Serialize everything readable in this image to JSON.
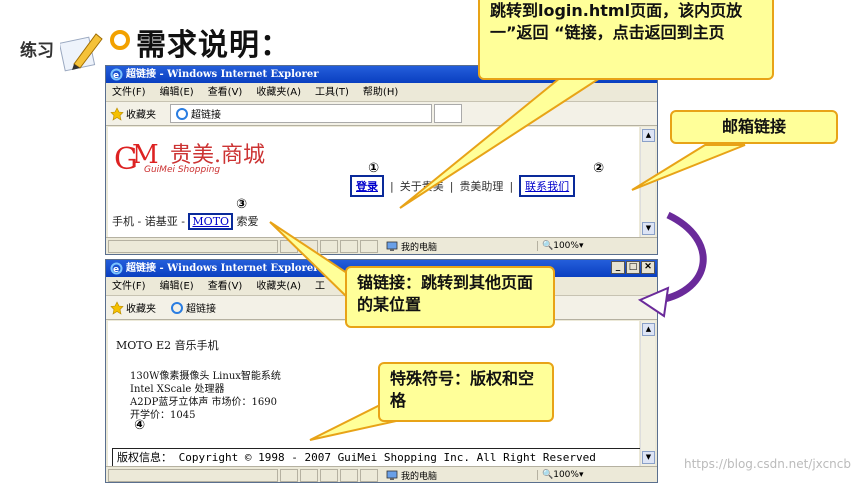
{
  "header": {
    "practice_label": "练习",
    "title": "需求说明："
  },
  "window1": {
    "title": "超链接 - Windows Internet Explorer",
    "menu": [
      "文件(F)",
      "编辑(E)",
      "查看(V)",
      "收藏夹(A)",
      "工具(T)",
      "帮助(H)"
    ],
    "favorites_label": "收藏夹",
    "tab_label": "超链接",
    "logo_text": "贵美.商城",
    "logo_sub": "GuiMei Shopping",
    "nav": [
      "登录",
      "关于贵美",
      "贵美助理",
      "联系我们"
    ],
    "marker1": "①",
    "marker2": "②",
    "marker3": "③",
    "phone_prefix": "手机 - 诺基亚 - ",
    "moto_link": "MOTO",
    "phone_suffix": " 索爱",
    "status_zone": "我的电脑",
    "zoom": "100%"
  },
  "window2": {
    "title": "超链接 - Windows Internet Explorer",
    "menu": [
      "文件(F)",
      "编辑(E)",
      "查看(V)",
      "收藏夹(A)",
      "工"
    ],
    "favorites_label": "收藏夹",
    "tab_label": "超链接",
    "heading": "MOTO E2 音乐手机",
    "specs": [
      "130W像素摄像头 Linux智能系统",
      "Intel XScale 处理器",
      "A2DP蓝牙立体声 市场价：1690",
      "开学价：1045"
    ],
    "marker4": "④",
    "copyright": "版权信息：  Copyright © 1998 - 2007 GuiMei Shopping Inc. All Right Reserved",
    "status_zone": "我的电脑",
    "zoom": "100%"
  },
  "callouts": {
    "login": "跳转到login.html页面，该内页放一”返回 “链接，点击返回到主页",
    "mail": "邮箱链接",
    "anchor": "锚链接：跳转到其他页面的某位置",
    "special": "特殊符号：版权和空格"
  },
  "watermark": "https://blog.csdn.net/jxcncb",
  "colors": {
    "callout_bg": "#ffff99",
    "callout_border": "#e8a317",
    "link": "#0000cc",
    "ie_titlebar": "#245edb"
  }
}
